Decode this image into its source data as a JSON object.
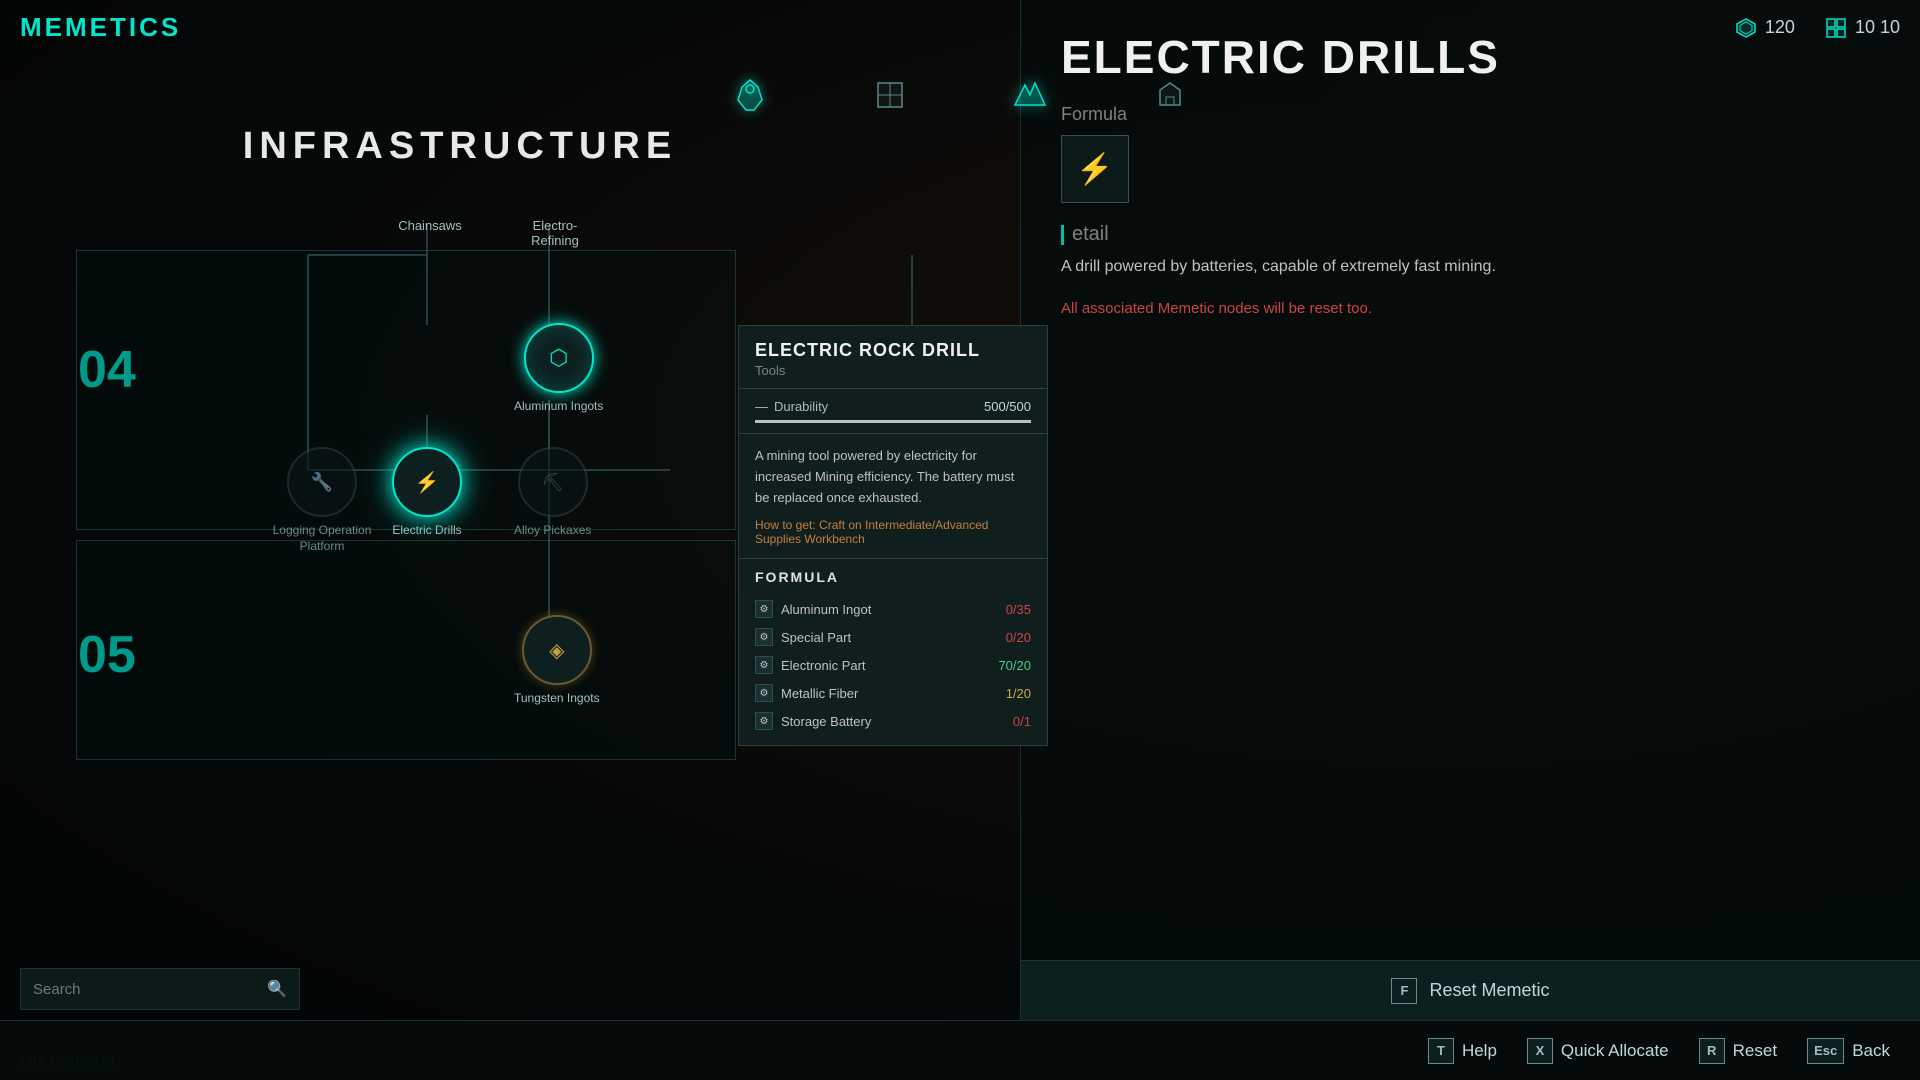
{
  "app": {
    "title": "MEMETICS",
    "uid": "UID: 150023729"
  },
  "stats": {
    "resource1_icon": "⬡",
    "resource1_value": "120",
    "resource2_icon": "⊞",
    "resource2_value": "10 10"
  },
  "section": {
    "title": "INFRASTRUCTURE",
    "row04": "04",
    "row05": "05"
  },
  "nodes": [
    {
      "id": "chainsaws",
      "label": "Chainsaws",
      "state": "inactive"
    },
    {
      "id": "electro-refining",
      "label": "Electro-Refining",
      "state": "inactive"
    },
    {
      "id": "aluminum-ingots",
      "label": "Aluminum Ingots",
      "state": "active"
    },
    {
      "id": "logging-operation",
      "label": "Logging Operation Platform",
      "state": "dim"
    },
    {
      "id": "electric-drills",
      "label": "Electric Drills",
      "state": "selected"
    },
    {
      "id": "alloy-pickaxes",
      "label": "Alloy Pickaxes",
      "state": "dim"
    },
    {
      "id": "tungsten-ingots",
      "label": "Tungsten Ingots",
      "state": "inactive"
    },
    {
      "id": "unknown-right",
      "label": "",
      "state": "inactive"
    }
  ],
  "right_panel": {
    "title": "ELECTRIC DRILLS",
    "formula_label": "Formula",
    "detail_label": "etail",
    "description": "A drill powered by batteries, capable of extremely fast mining."
  },
  "tooltip": {
    "title": "ELECTRIC ROCK DRILL",
    "subtitle": "Tools",
    "durability_label": "Durability",
    "durability_current": "500",
    "durability_max": "500",
    "durability_display": "500/500",
    "description": "A mining tool powered by electricity for increased Mining efficiency. The battery must be replaced once exhausted.",
    "how_to_get": "How to get: Craft on Intermediate/Advanced Supplies Workbench",
    "formula_title": "FORMULA",
    "ingredients": [
      {
        "name": "Aluminum Ingot",
        "count": "0/35",
        "status": "red"
      },
      {
        "name": "Special Part",
        "count": "0/20",
        "status": "red"
      },
      {
        "name": "Electronic Part",
        "count": "70/20",
        "status": "green"
      },
      {
        "name": "Metallic Fiber",
        "count": "1/20",
        "status": "red"
      },
      {
        "name": "Storage Battery",
        "count": "0/1",
        "status": "red"
      }
    ]
  },
  "reset_panel": {
    "warning": "All associated Memetic nodes will be reset too.",
    "button_key": "F",
    "button_label": "Reset Memetic"
  },
  "search": {
    "placeholder": "Search",
    "value": ""
  },
  "bottom_actions": [
    {
      "key": "T",
      "label": "Help"
    },
    {
      "key": "X",
      "label": "Quick Allocate"
    },
    {
      "key": "R",
      "label": "Reset"
    },
    {
      "key": "Esc",
      "label": "Back"
    }
  ]
}
